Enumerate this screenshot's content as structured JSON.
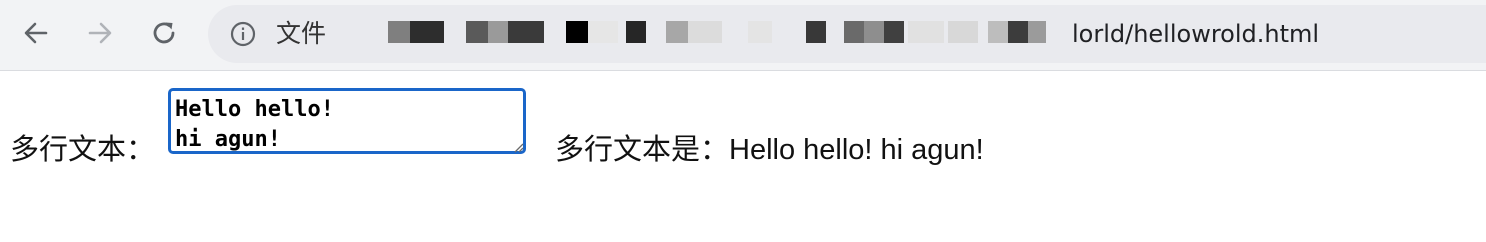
{
  "browser": {
    "address_bar": {
      "scheme_label": "文件",
      "url_visible_tail": "lorld/hellowrold.html",
      "icon": "info-icon"
    },
    "nav": {
      "back_icon": "back-arrow-icon",
      "forward_icon": "forward-arrow-icon",
      "reload_icon": "reload-icon"
    }
  },
  "page": {
    "textarea_label": "多行文本：",
    "textarea_value": "Hello hello!\nhi agun!",
    "result_label": "多行文本是：",
    "result_value": "Hello hello! hi agun!"
  },
  "colors": {
    "focus_ring": "#1a66c9",
    "toolbar_bg": "#f2f3f5",
    "omnibox_bg": "#e9eaee"
  }
}
